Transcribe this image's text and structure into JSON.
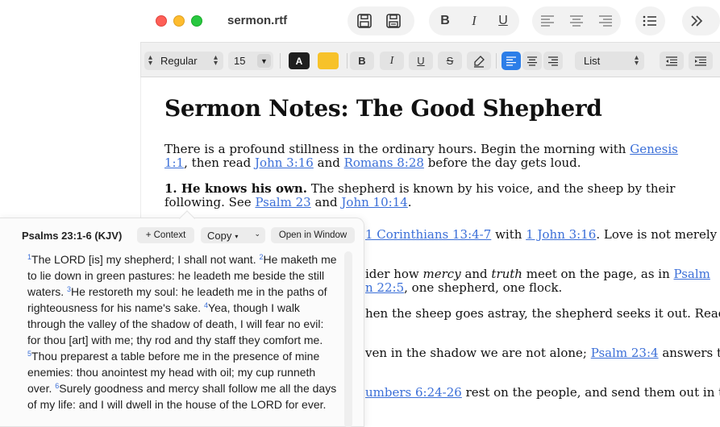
{
  "window": {
    "title": "sermon.rtf"
  },
  "toolbar": {
    "save_icon": "save-icon",
    "save_as_icon": "save-as-icon",
    "bold": "B",
    "italic": "I",
    "underline": "U",
    "more_icon": "chevron-double-right-icon"
  },
  "formatbar": {
    "style": "Regular",
    "size": "15",
    "text_color_label": "A",
    "text_color": "#1f1f1f",
    "highlight_color": "#f7c22a",
    "bold": "B",
    "italic": "I",
    "underline": "U",
    "strike": "S",
    "list": "List",
    "accent": "#2c7ee8"
  },
  "document": {
    "title": "Sermon Notes: The Good Shepherd",
    "p1": {
      "t1": "There is a profound stillness in the ordinary hours. Begin the morning with ",
      "l1": "Genesis 1:1",
      "t2": ", then read ",
      "l2": "John 3:16",
      "t3": " and ",
      "l3": "Romans 8:28",
      "t4": " before the day gets loud."
    },
    "p2": {
      "bold": "1. He knows his own.",
      "t1": " The shepherd is known by his voice, and the sheep by their following. See ",
      "l1": "Psalm 23",
      "t2": " and ",
      "l2": "John 10:14",
      "t3": "."
    },
    "p3": {
      "l1": "1 Corinthians 13:4-7",
      "t1": " with ",
      "l2": "1 John 3:16",
      "t2": ". Love is not merely felt;"
    },
    "p4": {
      "t1": "ider how ",
      "em1": "mercy",
      "t2": " and ",
      "em2": "truth",
      "t3": " meet on the page, as in ",
      "l1": "Psalm"
    },
    "p4b": {
      "l1": "n 22:5",
      "t1": ", one shepherd, one flock."
    },
    "p5": {
      "t1": "hen the sheep goes astray, the shepherd seeks it out. Read"
    },
    "p6": {
      "t1": "ven in the shadow we are not alone; ",
      "l1": "Psalm 23:4",
      "t2": " answers the"
    },
    "p7": {
      "l1": "umbers 6:24-26",
      "t1": " rest on the people, and send them out in the"
    },
    "link_color": "#3b6fd8"
  },
  "popover": {
    "reference": "Psalms 23:1-6 (KJV)",
    "context_label": "+ Context",
    "copy_label": "Copy",
    "open_label": "Open in Window",
    "verses": [
      {
        "n": "1",
        "text": "The LORD [is] my shepherd; I shall not want. "
      },
      {
        "n": "2",
        "text": "He maketh me to lie down in green pastures: he leadeth me beside the still waters. "
      },
      {
        "n": "3",
        "text": "He restoreth my soul: he leadeth me in the paths of righteousness for his name's sake. "
      },
      {
        "n": "4",
        "text": "Yea, though I walk through the valley of the shadow of death, I will fear no evil: for thou [art] with me; thy rod and thy staff they comfort me. "
      },
      {
        "n": "5",
        "text": "Thou preparest a table before me in the presence of mine enemies: thou anointest my head with oil; my cup runneth over. "
      },
      {
        "n": "6",
        "text": "Surely goodness and mercy shall follow me all the days of my life: and I will dwell in the house of the LORD for ever."
      }
    ]
  }
}
